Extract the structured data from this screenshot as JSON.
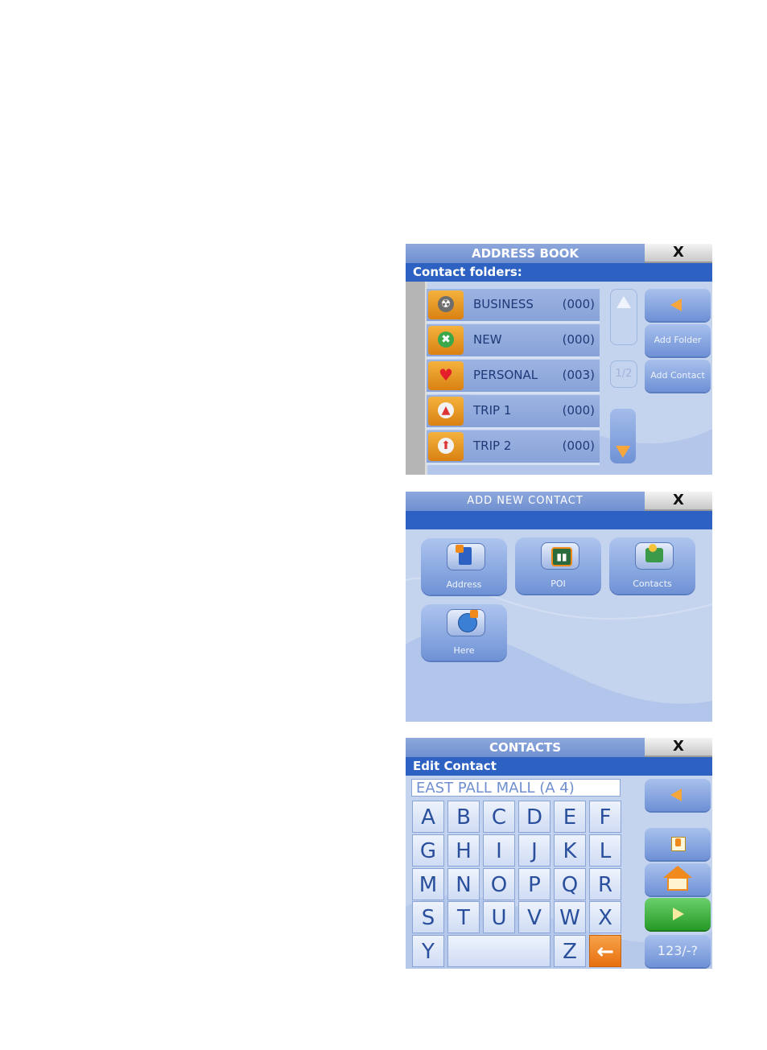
{
  "address_book": {
    "title": "ADDRESS BOOK",
    "close_label": "X",
    "subtitle": "Contact folders:",
    "folders": [
      {
        "name": "BUSINESS",
        "count": "(000)",
        "icon": "business-folder-icon"
      },
      {
        "name": "NEW",
        "count": "(000)",
        "icon": "new-folder-icon"
      },
      {
        "name": "PERSONAL",
        "count": "(003)",
        "icon": "heart-folder-icon"
      },
      {
        "name": "TRIP 1",
        "count": "(000)",
        "icon": "trip-folder-icon"
      },
      {
        "name": "TRIP 2",
        "count": "(000)",
        "icon": "trip-folder-icon"
      }
    ],
    "page_indicator": "1/2",
    "add_folder_label": "Add Folder",
    "add_contact_label": "Add Contact"
  },
  "add_new_contact": {
    "title": "ADD NEW CONTACT",
    "close_label": "X",
    "options": [
      {
        "label": "Address",
        "icon": "address-icon"
      },
      {
        "label": "POI",
        "icon": "poi-icon"
      },
      {
        "label": "Contacts",
        "icon": "contacts-icon"
      },
      {
        "label": "Here",
        "icon": "globe-here-icon"
      }
    ]
  },
  "contacts": {
    "title": "CONTACTS",
    "close_label": "X",
    "subtitle": "Edit Contact",
    "input_value": "EAST PALL MALL (A 4)",
    "keys": {
      "row1": [
        "A",
        "B",
        "C",
        "D",
        "E",
        "F"
      ],
      "row2": [
        "G",
        "H",
        "I",
        "J",
        "K",
        "L"
      ],
      "row3": [
        "M",
        "N",
        "O",
        "P",
        "Q",
        "R"
      ],
      "row4": [
        "S",
        "T",
        "U",
        "V",
        "W",
        "X"
      ],
      "y": "Y",
      "z": "Z",
      "backspace": "←"
    },
    "mode_label": "123/-?"
  },
  "colors": {
    "title_bar": "#7a99d6",
    "sub_bar": "#2e62c2",
    "screen_bg": "#c5d4ee",
    "accent_orange": "#f08a1c",
    "go_green": "#2fa52f"
  }
}
